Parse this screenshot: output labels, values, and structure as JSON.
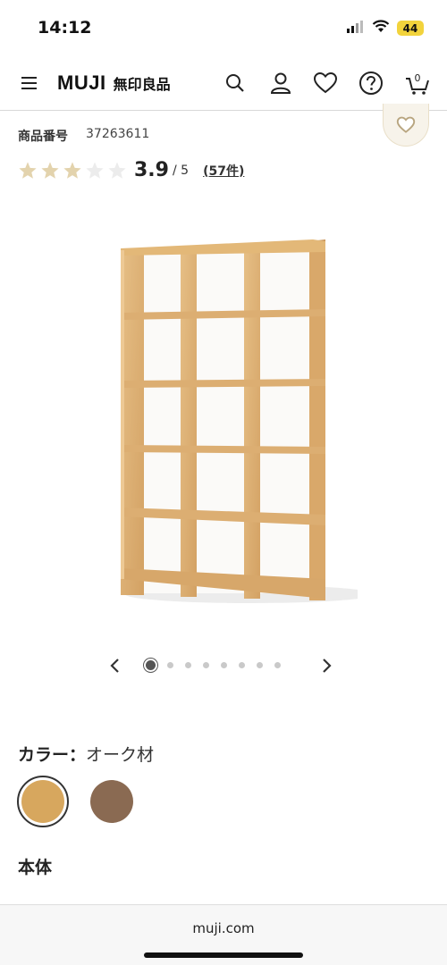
{
  "status_bar": {
    "time": "14:12",
    "battery": "44"
  },
  "header": {
    "logo_en": "MUJI",
    "logo_jp": "無印良品",
    "cart_count": "0",
    "icons": [
      "menu-icon",
      "search-icon",
      "account-icon",
      "heart-icon",
      "help-icon",
      "cart-icon"
    ]
  },
  "product": {
    "sku_label": "商品番号",
    "sku_value": "37263611",
    "rating_value": 3.9,
    "rating_score": "3.9",
    "rating_max": "/ 5",
    "review_count": "(57件)",
    "image_name": "oak-shelf-image"
  },
  "carousel": {
    "total": 8,
    "active_index": 0
  },
  "color": {
    "label": "カラー：",
    "value": "オーク材",
    "swatches": [
      {
        "name": "oak",
        "hex": "#d7a75e",
        "selected": true
      },
      {
        "name": "walnut",
        "hex": "#8a6a52",
        "selected": false
      }
    ]
  },
  "section_title": "本体",
  "browser": {
    "url": "muji.com"
  },
  "colors": {
    "star_filled": "#e3d3ad",
    "star_empty": "#ececec",
    "fav_bg": "#f7f3ea"
  }
}
